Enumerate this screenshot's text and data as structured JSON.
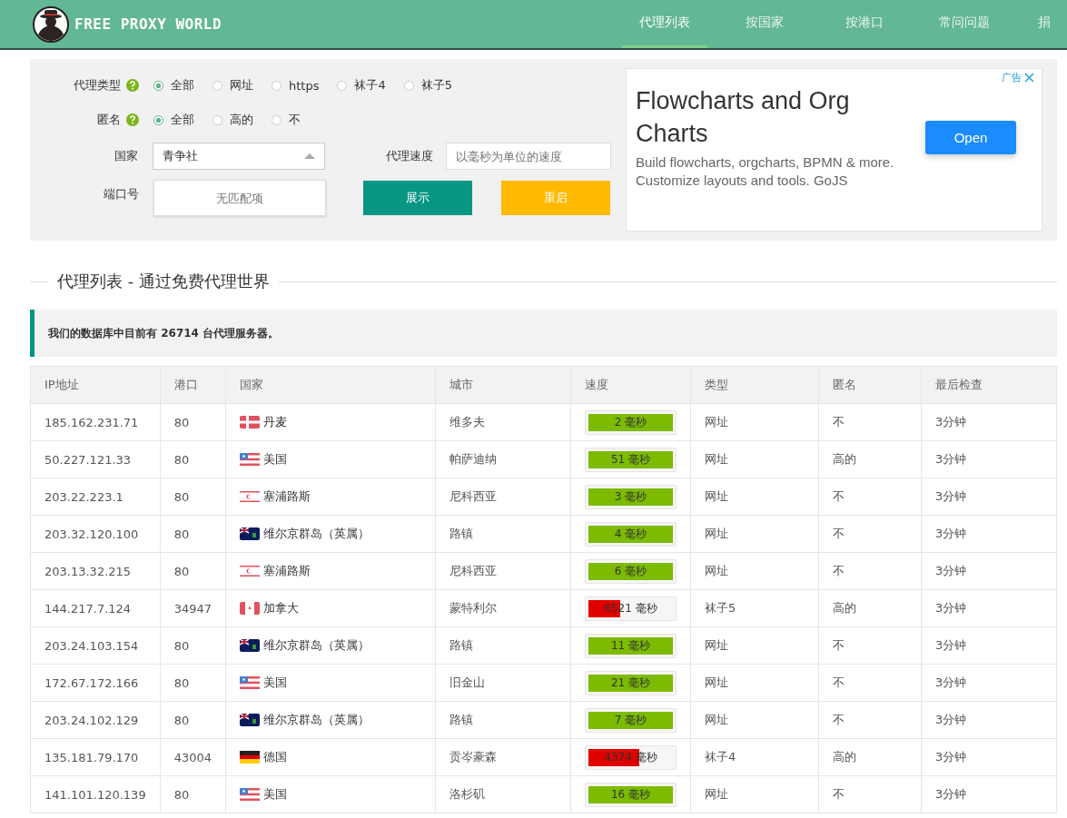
{
  "header": {
    "logo": "FREE PROXY WORLD",
    "nav": [
      {
        "label": "代理列表",
        "selected": true
      },
      {
        "label": "按国家",
        "selected": false
      },
      {
        "label": "按港口",
        "selected": false
      },
      {
        "label": "常问问题",
        "selected": false
      },
      {
        "label": "捐",
        "selected": false
      }
    ]
  },
  "filters": {
    "proxy_type": {
      "label": "代理类型",
      "options": [
        {
          "label": "全部",
          "selected": true
        },
        {
          "label": "网址",
          "selected": false
        },
        {
          "label": "https",
          "selected": false
        },
        {
          "label": "袜子4",
          "selected": false
        },
        {
          "label": "袜子5",
          "selected": false
        }
      ]
    },
    "anonymity": {
      "label": "匿名",
      "options": [
        {
          "label": "全部",
          "selected": true
        },
        {
          "label": "高的",
          "selected": false
        },
        {
          "label": "不",
          "selected": false
        }
      ]
    },
    "country": {
      "label": "国家",
      "value": "青争社"
    },
    "speed": {
      "label": "代理速度",
      "placeholder": "以毫秒为单位的速度"
    },
    "port": {
      "label": "端口号",
      "placeholder": "无匹配项"
    },
    "buttons": [
      "展示",
      "重启"
    ]
  },
  "ad": {
    "badge": "广告",
    "title": "Flowcharts and Org Charts",
    "body": "Build flowcharts, orgcharts, BPMN & more. Customize layouts and tools. GoJS",
    "button": "Open"
  },
  "section_title": "代理列表 - 通过免费代理世界",
  "notice": "我们的数据库中目前有 26714 台代理服务器。",
  "table": {
    "columns": [
      "IP地址",
      "港口",
      "国家",
      "城市",
      "速度",
      "类型",
      "匿名",
      "最后检查"
    ],
    "rows": [
      {
        "ip": "185.162.231.71",
        "port": "80",
        "kind": "dk",
        "country": "丹麦",
        "city": "维多夫",
        "speed": "2 毫秒",
        "level": 1,
        "color": "#7cbb00",
        "type": "网址",
        "anonymity": "不",
        "checked": "3分钟"
      },
      {
        "ip": "50.227.121.33",
        "port": "80",
        "kind": "us",
        "country": "美国",
        "city": "帕萨迪纳",
        "speed": "51 毫秒",
        "level": 1,
        "color": "#7cbb00",
        "type": "网址",
        "anonymity": "高的",
        "checked": "3分钟"
      },
      {
        "ip": "203.22.223.1",
        "port": "80",
        "kind": "cy",
        "country": "塞浦路斯",
        "city": "尼科西亚",
        "speed": "3 毫秒",
        "level": 1,
        "color": "#7cbb00",
        "type": "网址",
        "anonymity": "不",
        "checked": "3分钟"
      },
      {
        "ip": "203.32.120.100",
        "port": "80",
        "kind": "vg",
        "country": "维尔京群岛（英属）",
        "city": "路镇",
        "speed": "4 毫秒",
        "level": 1,
        "color": "#7cbb00",
        "type": "网址",
        "anonymity": "不",
        "checked": "3分钟"
      },
      {
        "ip": "203.13.32.215",
        "port": "80",
        "kind": "cy",
        "country": "塞浦路斯",
        "city": "尼科西亚",
        "speed": "6 毫秒",
        "level": 1,
        "color": "#7cbb00",
        "type": "网址",
        "anonymity": "不",
        "checked": "3分钟"
      },
      {
        "ip": "144.217.7.124",
        "port": "34947",
        "kind": "ca",
        "country": "加拿大",
        "city": "蒙特利尔",
        "speed": "6521 毫秒",
        "level": 0.38,
        "color": "#e00000",
        "type": "袜子5",
        "anonymity": "高的",
        "checked": "3分钟"
      },
      {
        "ip": "203.24.103.154",
        "port": "80",
        "kind": "vg",
        "country": "维尔京群岛（英属）",
        "city": "路镇",
        "speed": "11 毫秒",
        "level": 1,
        "color": "#7cbb00",
        "type": "网址",
        "anonymity": "不",
        "checked": "3分钟"
      },
      {
        "ip": "172.67.172.166",
        "port": "80",
        "kind": "us",
        "country": "美国",
        "city": "旧金山",
        "speed": "21 毫秒",
        "level": 1,
        "color": "#7cbb00",
        "type": "网址",
        "anonymity": "不",
        "checked": "3分钟"
      },
      {
        "ip": "203.24.102.129",
        "port": "80",
        "kind": "vg",
        "country": "维尔京群岛（英属）",
        "city": "路镇",
        "speed": "7 毫秒",
        "level": 1,
        "color": "#7cbb00",
        "type": "网址",
        "anonymity": "不",
        "checked": "3分钟"
      },
      {
        "ip": "135.181.79.170",
        "port": "43004",
        "kind": "de",
        "country": "德国",
        "city": "贡岑豪森",
        "speed": "4374 毫秒",
        "level": 0.6,
        "color": "#e00000",
        "type": "袜子4",
        "anonymity": "高的",
        "checked": "3分钟"
      },
      {
        "ip": "141.101.120.139",
        "port": "80",
        "kind": "us",
        "country": "美国",
        "city": "洛杉矶",
        "speed": "16 毫秒",
        "level": 1,
        "color": "#7cbb00",
        "type": "网址",
        "anonymity": "不",
        "checked": "3分钟"
      }
    ]
  }
}
